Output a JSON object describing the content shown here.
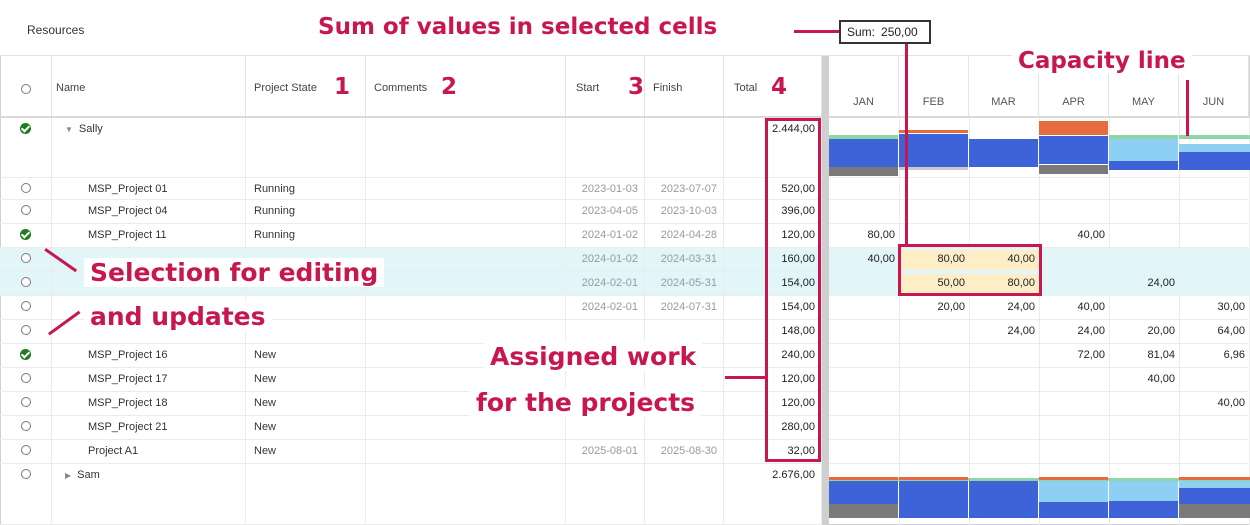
{
  "toolbar": {
    "title": "Resources",
    "sum_label": "Sum:",
    "sum_value": "250,00"
  },
  "columns": {
    "name": "Name",
    "state": "Project State",
    "comments": "Comments",
    "start": "Start",
    "finish": "Finish",
    "total": "Total"
  },
  "months": [
    "JAN",
    "FEB",
    "MAR",
    "APR",
    "MAY",
    "JUN"
  ],
  "rows": [
    {
      "sel": "check",
      "name": "Sally",
      "group": true,
      "expanded": true,
      "state": "",
      "start": "",
      "finish": "",
      "total": "2.444,00"
    },
    {
      "sel": "radio",
      "name": "MSP_Project 01",
      "state": "Running",
      "start": "2023-01-03",
      "finish": "2023-07-07",
      "total": "520,00",
      "months": [
        "",
        "",
        "",
        "",
        "",
        ""
      ]
    },
    {
      "sel": "radio",
      "name": "MSP_Project 04",
      "state": "Running",
      "start": "2023-04-05",
      "finish": "2023-10-03",
      "total": "396,00",
      "months": [
        "",
        "",
        "",
        "",
        "",
        ""
      ]
    },
    {
      "sel": "check",
      "name": "MSP_Project 11",
      "state": "Running",
      "start": "2024-01-02",
      "finish": "2024-04-28",
      "total": "120,00",
      "months": [
        "80,00",
        "",
        "",
        "40,00",
        "",
        ""
      ]
    },
    {
      "sel": "radio",
      "name": "",
      "state": "",
      "start": "2024-01-02",
      "finish": "2024-03-31",
      "total": "160,00",
      "highlight": true,
      "months": [
        "40,00",
        "80,00",
        "40,00",
        "",
        "",
        ""
      ]
    },
    {
      "sel": "radio",
      "name": "",
      "state": "",
      "start": "2024-02-01",
      "finish": "2024-05-31",
      "total": "154,00",
      "highlight": true,
      "months": [
        "",
        "50,00",
        "80,00",
        "",
        "24,00",
        ""
      ]
    },
    {
      "sel": "radio",
      "name": "",
      "state": "",
      "start": "2024-02-01",
      "finish": "2024-07-31",
      "total": "154,00",
      "months": [
        "",
        "20,00",
        "24,00",
        "40,00",
        "",
        "30,00"
      ]
    },
    {
      "sel": "radio",
      "name": "",
      "state": "",
      "start": "",
      "finish": "",
      "total": "148,00",
      "months": [
        "",
        "",
        "24,00",
        "24,00",
        "20,00",
        "64,00"
      ]
    },
    {
      "sel": "check",
      "name": "MSP_Project 16",
      "state": "New",
      "start": "",
      "finish": "",
      "total": "240,00",
      "months": [
        "",
        "",
        "",
        "72,00",
        "81,04",
        "6,96"
      ]
    },
    {
      "sel": "radio",
      "name": "MSP_Project 17",
      "state": "New",
      "start": "",
      "finish": "",
      "total": "120,00",
      "months": [
        "",
        "",
        "",
        "",
        "40,00",
        ""
      ]
    },
    {
      "sel": "radio",
      "name": "MSP_Project 18",
      "state": "New",
      "start": "",
      "finish": "",
      "total": "120,00",
      "months": [
        "",
        "",
        "",
        "",
        "",
        "40,00"
      ]
    },
    {
      "sel": "radio",
      "name": "MSP_Project 21",
      "state": "New",
      "start": "",
      "finish": "",
      "total": "280,00",
      "months": [
        "",
        "",
        "",
        "",
        "",
        ""
      ]
    },
    {
      "sel": "radio",
      "name": "Project A1",
      "state": "New",
      "start": "2025-08-01",
      "finish": "2025-08-30",
      "total": "32,00",
      "months": [
        "",
        "",
        "",
        "",
        "",
        ""
      ]
    },
    {
      "sel": "radio",
      "name": "Sam",
      "group": true,
      "expanded": false,
      "state": "",
      "start": "",
      "finish": "",
      "total": "2.676,00"
    }
  ],
  "annotations": {
    "sum": "Sum of values in selected cells",
    "capacity": "Capacity line",
    "selection_1": "Selection for editing",
    "selection_2": "and updates",
    "assigned_1": "Assigned work",
    "assigned_2": "for the projects",
    "n1": "1",
    "n2": "2",
    "n3": "3",
    "n4": "4"
  },
  "colors": {
    "accent": "#c8174e",
    "check": "#1e7e1e",
    "highlight_row": "#e2f6f9",
    "selected_cell": "#fdeec8",
    "bar_blue": "#3e63d8",
    "bar_light": "#8ecff4",
    "bar_over": "#e86a3f",
    "bar_gray": "#7a7a7a",
    "capacity": "#8fd6a6"
  }
}
